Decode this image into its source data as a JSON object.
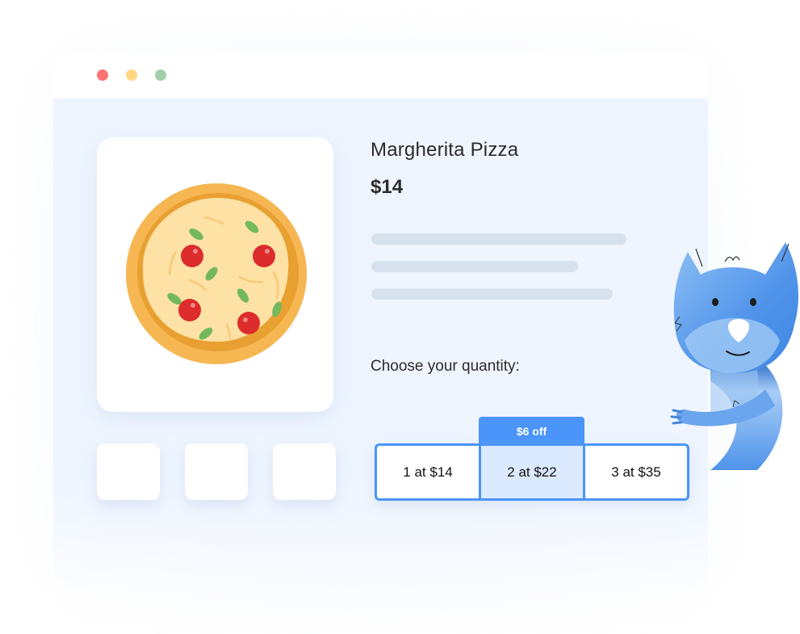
{
  "window": {
    "controls": [
      {
        "name": "close",
        "color": "#fe7474"
      },
      {
        "name": "minimize",
        "color": "#ffd683"
      },
      {
        "name": "maximize",
        "color": "#a2cfab"
      }
    ]
  },
  "product": {
    "image_icon": "pizza-illustration",
    "thumbnail_count": 3,
    "title": "Margherita Pizza",
    "price": "$14",
    "description_placeholder_lines": 3
  },
  "quantity": {
    "label": "Choose your quantity:",
    "discount_badge": "$6 off",
    "options": [
      {
        "label": "1 at $14",
        "selected": false
      },
      {
        "label": "2 at $22",
        "selected": true
      },
      {
        "label": "3 at $35",
        "selected": false
      }
    ],
    "accent_color": "#4a94fa",
    "selected_bg": "#dbe9fe"
  },
  "mascot": {
    "icon": "blue-cat-mascot"
  }
}
